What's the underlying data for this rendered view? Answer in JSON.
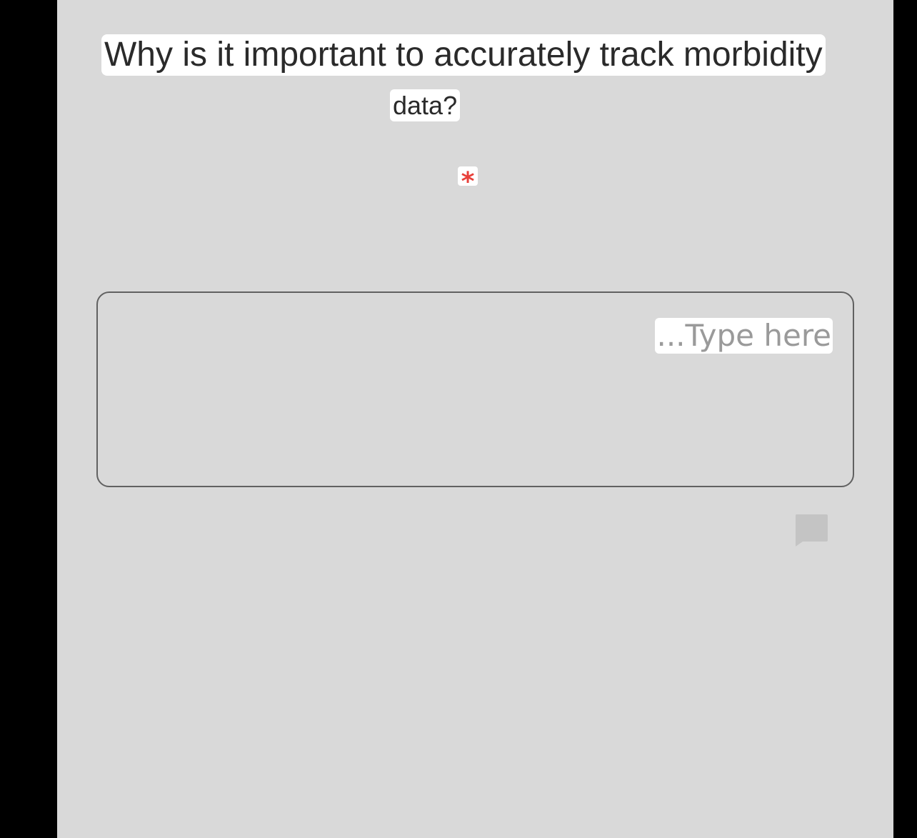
{
  "question": {
    "line1": "Why is it important to accurately track morbidity",
    "line2": "data?",
    "required_marker": "*"
  },
  "answer": {
    "placeholder": "...Type here",
    "value": ""
  },
  "icons": {
    "comment": "comment-icon"
  },
  "colors": {
    "background": "#d9d9d9",
    "required": "#e8403a",
    "placeholder": "#9a9a9a",
    "icon": "#c4c4c4"
  }
}
